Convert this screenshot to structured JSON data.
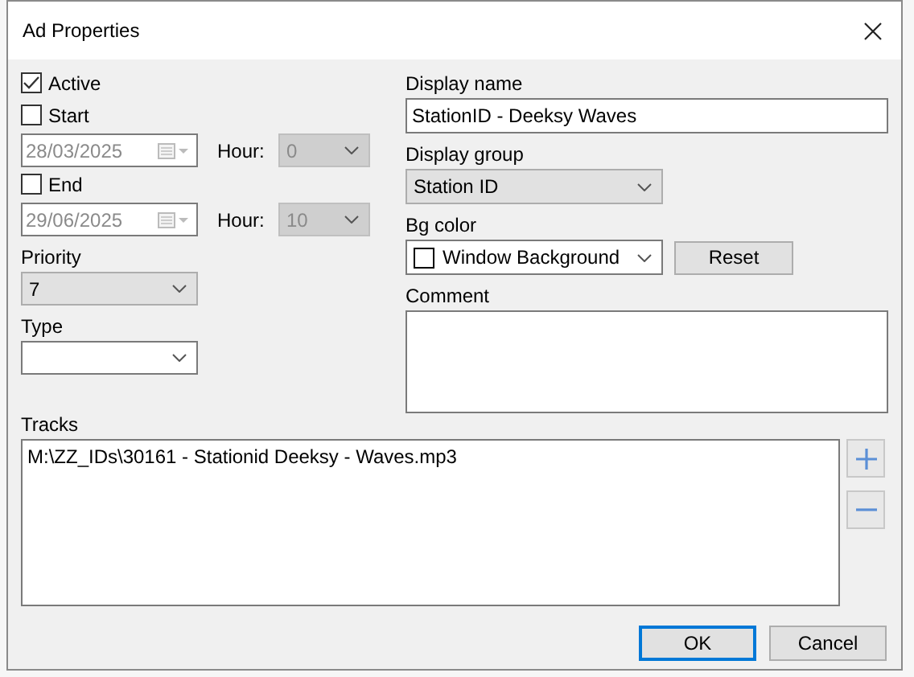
{
  "window": {
    "title": "Ad Properties"
  },
  "active": {
    "label": "Active",
    "checked": true
  },
  "start": {
    "label": "Start",
    "checked": false,
    "date": "28/03/2025",
    "hour_label": "Hour:",
    "hour": "0",
    "hour_disabled": true
  },
  "end": {
    "label": "End",
    "checked": false,
    "date": "29/06/2025",
    "hour_label": "Hour:",
    "hour": "10",
    "hour_disabled": true
  },
  "priority": {
    "label": "Priority",
    "value": "7"
  },
  "type": {
    "label": "Type"
  },
  "display_name": {
    "label": "Display name",
    "value": "StationID - Deeksy Waves"
  },
  "display_group": {
    "label": "Display group",
    "value": "Station ID"
  },
  "bg_color": {
    "label": "Bg color",
    "value": "Window Background",
    "reset": "Reset"
  },
  "comment": {
    "label": "Comment"
  },
  "tracks": {
    "label": "Tracks",
    "items": [
      "M:\\ZZ_IDs\\30161 - Stationid Deeksy - Waves.mp3"
    ]
  },
  "buttons": [
    {
      "label": "OK",
      "default": true
    },
    {
      "label": "Cancel",
      "default": false
    }
  ]
}
